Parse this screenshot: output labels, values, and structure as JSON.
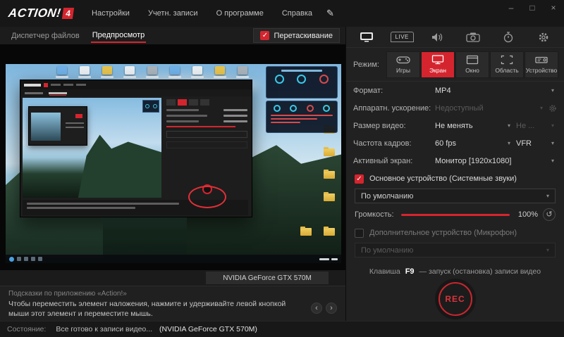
{
  "colors": {
    "accent": "#d4252e",
    "panel_bg": "#212121",
    "gauge_cyan": "#3ac8e8"
  },
  "glyphs": {
    "chevron": "▾",
    "check": "✓",
    "reset": "↺",
    "prev": "‹",
    "next": "›",
    "minimize": "–",
    "maximize": "□",
    "close": "×",
    "brush": "✎"
  },
  "titlebar": {
    "logo": "ACTION!",
    "logo_version": "4",
    "menus": [
      "Настройки",
      "Учетн. записи",
      "О программе",
      "Справка"
    ]
  },
  "tabs": {
    "file_manager": "Диспетчер файлов",
    "preview": "Предпросмотр",
    "drag_label": "Перетаскивание"
  },
  "preview": {
    "gpu_label": "NVIDIA GeForce GTX 570M"
  },
  "tips": {
    "header": "Подсказки по приложению «Action!»",
    "text": "Чтобы переместить элемент наложения, нажмите и удерживайте левой кнопкой мыши этот элемент и переместите мышь."
  },
  "statusbar": {
    "label": "Состояние:",
    "message": "Все готово к записи видео...",
    "gpu": "(NVIDIA GeForce GTX 570M)"
  },
  "panel": {
    "live_label": "LIVE",
    "mode": {
      "label": "Режим:",
      "items": [
        {
          "label": "Игры"
        },
        {
          "label": "Экран"
        },
        {
          "label": "Окно"
        },
        {
          "label": "Область"
        },
        {
          "label": "Устройство"
        }
      ]
    },
    "rows": {
      "format": {
        "label": "Формат:",
        "value": "MP4"
      },
      "hw": {
        "label": "Аппаратн. ускорение:",
        "value": "Недоступный"
      },
      "size": {
        "label": "Размер видео:",
        "value": "Не менять",
        "value2": "Не ..."
      },
      "fps": {
        "label": "Частота кадров:",
        "value": "60 fps",
        "value2": "VFR"
      },
      "screen": {
        "label": "Активный экран:",
        "value": "Монитор [1920x1080]"
      }
    },
    "audio_primary": {
      "label": "Основное устройство (Системные звуки)",
      "device": "По умолчанию",
      "volume_label": "Громкость:",
      "volume_value": "100%"
    },
    "audio_secondary": {
      "label": "Дополнительное устройство (Микрофон)",
      "device": "По умолчанию"
    },
    "hotkey": {
      "prefix": "Клавиша",
      "key": "F9",
      "suffix": "— запуск (остановка) записи видео"
    },
    "rec_label": "REC"
  }
}
